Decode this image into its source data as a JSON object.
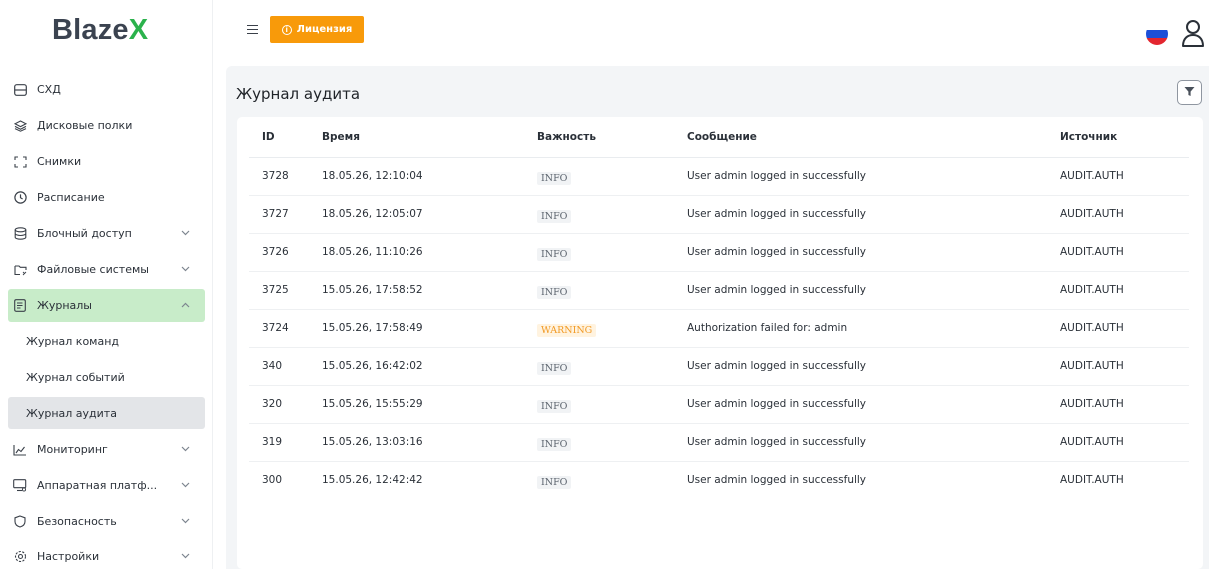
{
  "brand": {
    "logo_main": "Blaze",
    "logo_accent": "X"
  },
  "topbar": {
    "license_label": "Лицензия"
  },
  "sidebar": {
    "items": [
      {
        "label": "СХД",
        "icon": "storage-icon",
        "has_chevron": false
      },
      {
        "label": "Дисковые полки",
        "icon": "layers-icon",
        "has_chevron": false
      },
      {
        "label": "Снимки",
        "icon": "snapshot-icon",
        "has_chevron": false
      },
      {
        "label": "Расписание",
        "icon": "clock-icon",
        "has_chevron": false
      },
      {
        "label": "Блочный доступ",
        "icon": "database-icon",
        "has_chevron": true
      },
      {
        "label": "Файловые системы",
        "icon": "folder-icon",
        "has_chevron": true
      },
      {
        "label": "Журналы",
        "icon": "journal-icon",
        "has_chevron": true,
        "expanded": true
      },
      {
        "label": "Мониторинг",
        "icon": "chart-icon",
        "has_chevron": true
      },
      {
        "label": "Аппаратная платф...",
        "icon": "hardware-icon",
        "has_chevron": true
      },
      {
        "label": "Безопасность",
        "icon": "shield-icon",
        "has_chevron": true
      },
      {
        "label": "Настройки",
        "icon": "gear-icon",
        "has_chevron": true
      }
    ],
    "subitems": [
      {
        "label": "Журнал команд"
      },
      {
        "label": "Журнал событий"
      },
      {
        "label": "Журнал аудита",
        "active": true
      }
    ]
  },
  "page": {
    "title": "Журнал аудита"
  },
  "table": {
    "headers": {
      "id": "ID",
      "time": "Время",
      "severity": "Важность",
      "message": "Сообщение",
      "source": "Источник"
    },
    "rows": [
      {
        "id": "3728",
        "time": "18.05.26, 12:10:04",
        "severity": "INFO",
        "message": "User admin logged in successfully",
        "source": "AUDIT.AUTH"
      },
      {
        "id": "3727",
        "time": "18.05.26, 12:05:07",
        "severity": "INFO",
        "message": "User admin logged in successfully",
        "source": "AUDIT.AUTH"
      },
      {
        "id": "3726",
        "time": "18.05.26, 11:10:26",
        "severity": "INFO",
        "message": "User admin logged in successfully",
        "source": "AUDIT.AUTH"
      },
      {
        "id": "3725",
        "time": "15.05.26, 17:58:52",
        "severity": "INFO",
        "message": "User admin logged in successfully",
        "source": "AUDIT.AUTH"
      },
      {
        "id": "3724",
        "time": "15.05.26, 17:58:49",
        "severity": "WARNING",
        "message": "Authorization failed for: admin",
        "source": "AUDIT.AUTH"
      },
      {
        "id": "340",
        "time": "15.05.26, 16:42:02",
        "severity": "INFO",
        "message": "User admin logged in successfully",
        "source": "AUDIT.AUTH"
      },
      {
        "id": "320",
        "time": "15.05.26, 15:55:29",
        "severity": "INFO",
        "message": "User admin logged in successfully",
        "source": "AUDIT.AUTH"
      },
      {
        "id": "319",
        "time": "15.05.26, 13:03:16",
        "severity": "INFO",
        "message": "User admin logged in successfully",
        "source": "AUDIT.AUTH"
      },
      {
        "id": "300",
        "time": "15.05.26, 12:42:42",
        "severity": "INFO",
        "message": "User admin logged in successfully",
        "source": "AUDIT.AUTH"
      }
    ]
  },
  "colors": {
    "brand_accent": "#2bb24c",
    "license_button": "#f89a0a",
    "active_nav": "#c8ecc9",
    "warning_text": "#f29a24"
  }
}
